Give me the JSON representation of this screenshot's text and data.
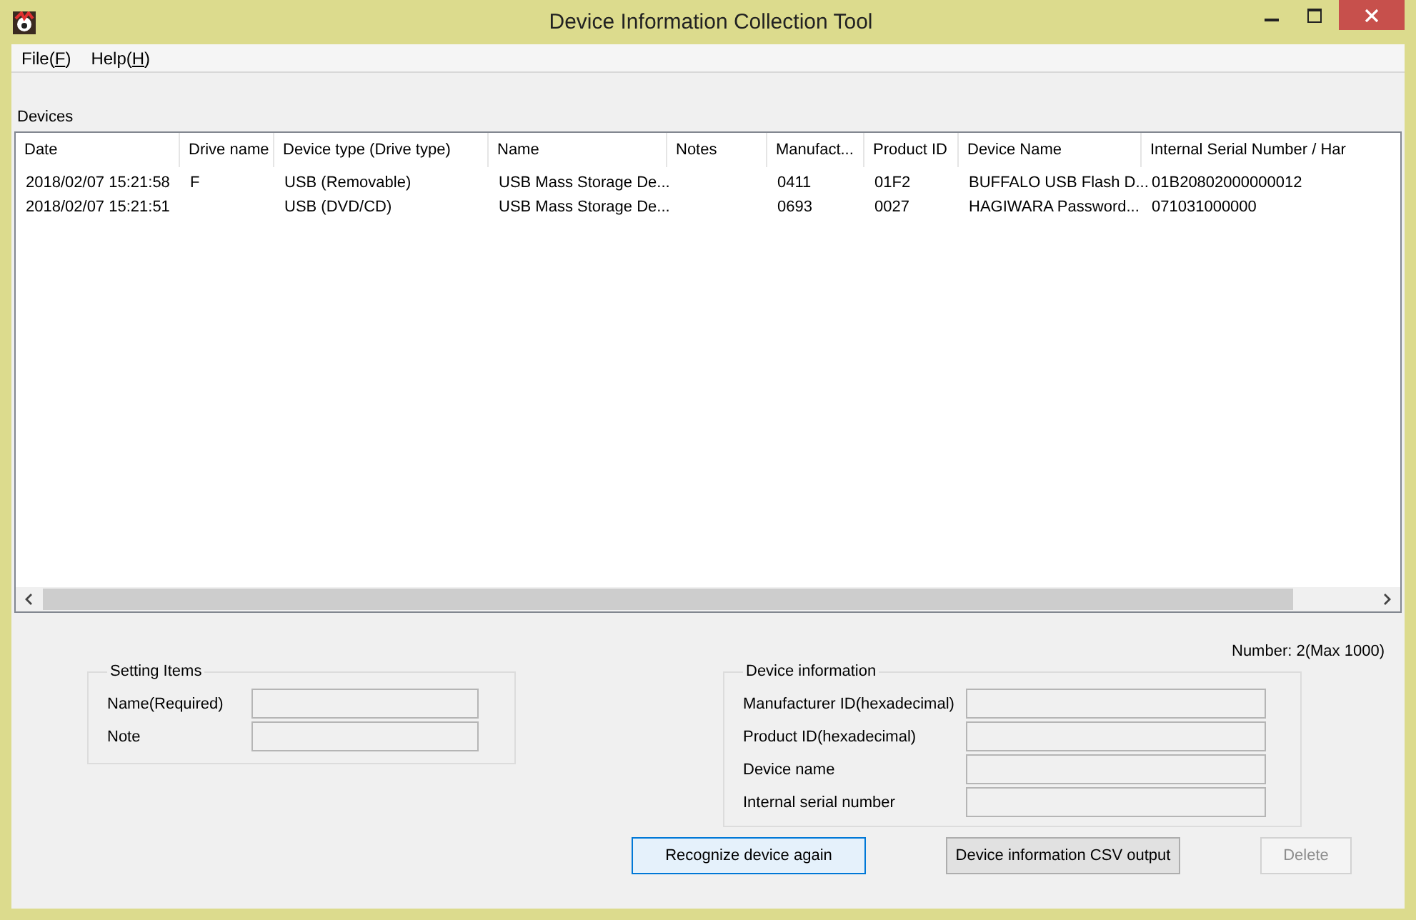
{
  "window": {
    "title": "Device Information Collection Tool"
  },
  "menu": [
    {
      "before": "File(",
      "key": "F",
      "after": ")"
    },
    {
      "before": "Help(",
      "key": "H",
      "after": ")"
    }
  ],
  "devices": {
    "label": "Devices",
    "columns": [
      "Date",
      "Drive name",
      "Device type (Drive type)",
      "Name",
      "Notes",
      "Manufact...",
      "Product ID",
      "Device Name",
      "Internal Serial Number / Har"
    ],
    "rows": [
      [
        "2018/02/07 15:21:58",
        "F",
        "USB (Removable)",
        "USB Mass Storage De...",
        "",
        "0411",
        "01F2",
        "BUFFALO USB Flash D...",
        "01B20802000000012"
      ],
      [
        "2018/02/07 15:21:51",
        "",
        "USB (DVD/CD)",
        "USB Mass Storage De...",
        "",
        "0693",
        "0027",
        "HAGIWARA Password...",
        "071031000000"
      ]
    ],
    "count": "Number: 2(Max 1000)"
  },
  "setting_items": {
    "title": "Setting Items",
    "fields": [
      {
        "label": "Name(Required)"
      },
      {
        "label": "Note"
      }
    ]
  },
  "device_information": {
    "title": "Device information",
    "fields": [
      {
        "label": "Manufacturer ID(hexadecimal)"
      },
      {
        "label": "Product ID(hexadecimal)"
      },
      {
        "label": "Device name"
      },
      {
        "label": "Internal serial number"
      }
    ]
  },
  "buttons": [
    {
      "label": "Recognize device again",
      "focused": true,
      "disabled": false
    },
    {
      "label": "Device information CSV output",
      "focused": false,
      "disabled": false
    },
    {
      "label": "Delete",
      "focused": false,
      "disabled": true
    }
  ]
}
